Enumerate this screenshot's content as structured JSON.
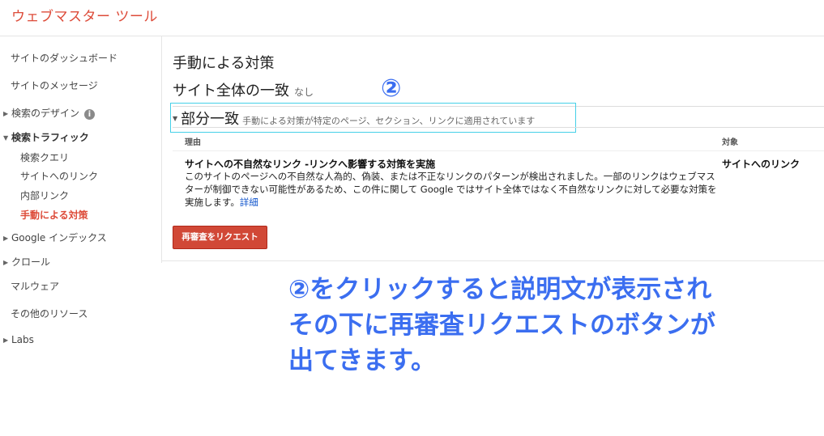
{
  "header": {
    "app_title": "ウェブマスター ツール"
  },
  "sidebar": {
    "items": [
      {
        "label": "サイトのダッシュボード"
      },
      {
        "label": "サイトのメッセージ"
      },
      {
        "label": "検索のデザイン"
      },
      {
        "label": "検索トラフィック"
      },
      {
        "label": "検索クエリ"
      },
      {
        "label": "サイトへのリンク"
      },
      {
        "label": "内部リンク"
      },
      {
        "label": "手動による対策"
      },
      {
        "label": "Google インデックス"
      },
      {
        "label": "クロール"
      },
      {
        "label": "マルウェア"
      },
      {
        "label": "その他のリソース"
      },
      {
        "label": "Labs"
      }
    ]
  },
  "main": {
    "page_title": "手動による対策",
    "site_wide": {
      "label": "サイト全体の一致",
      "status": "なし"
    },
    "partial": {
      "label": "部分一致",
      "description": "手動による対策が特定のページ、セクション、リンクに適用されています"
    },
    "table": {
      "columns": [
        "理由",
        "対象"
      ],
      "row": {
        "title": "サイトへの不自然なリンク -リンクへ影響する対策を実施",
        "body": "このサイトのページへの不自然な人為的、偽装、または不正なリンクのパターンが検出されました。一部のリンクはウェブマスターが制御できない可能性があるため、この件に関して Google ではサイト全体ではなく不自然なリンクに対して必要な対策を実施します。",
        "link": "詳細",
        "target": "サイトへのリンク"
      }
    },
    "review_button": "再審査をリクエスト"
  },
  "annotation": {
    "marker": "②",
    "lines": [
      "②をクリックすると説明文が表示され",
      "その下に再審査リクエストのボタンが",
      "出てきます。"
    ]
  },
  "colors": {
    "brand": "#dd4b39",
    "button": "#d14836",
    "annotation": "#3b6ef0",
    "highlight_box": "#45d0e8",
    "link": "#1155cc"
  }
}
